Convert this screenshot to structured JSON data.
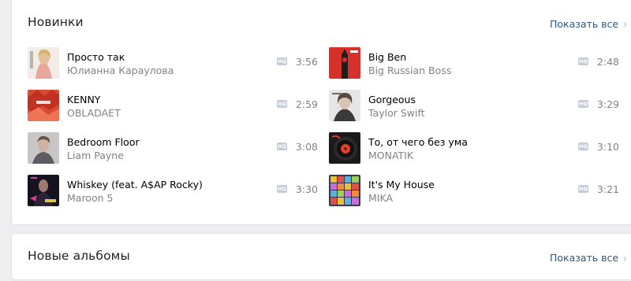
{
  "new_section": {
    "title": "Новинки",
    "show_all": "Показать все",
    "tracks": [
      {
        "title": "Просто так",
        "artist": "Юлианна Караулова",
        "quality": "HQ",
        "duration": "3:56",
        "cover_icon": "album-cover-photo-icon"
      },
      {
        "title": "Big Ben",
        "artist": "Big Russian Boss",
        "quality": "HQ",
        "duration": "2:48",
        "cover_icon": "album-cover-big-ben-icon"
      },
      {
        "title": "KENNY",
        "artist": "OBLADAET",
        "quality": "HQ",
        "duration": "2:59",
        "cover_icon": "album-cover-red-icon"
      },
      {
        "title": "Gorgeous",
        "artist": "Taylor Swift",
        "quality": "HQ",
        "duration": "3:29",
        "cover_icon": "album-cover-portrait-icon"
      },
      {
        "title": "Bedroom Floor",
        "artist": "Liam Payne",
        "quality": "HQ",
        "duration": "3:08",
        "cover_icon": "album-cover-portrait-icon"
      },
      {
        "title": "То, от чего без ума",
        "artist": "MONATIK",
        "quality": "HQ",
        "duration": "3:10",
        "cover_icon": "album-cover-vinyl-icon"
      },
      {
        "title": "Whiskey (feat. A$AP Rocky)",
        "artist": "Maroon 5",
        "quality": "HQ",
        "duration": "3:30",
        "cover_icon": "album-cover-dark-icon"
      },
      {
        "title": "It's My House",
        "artist": "MIKA",
        "quality": "HQ",
        "duration": "3:21",
        "cover_icon": "album-cover-colorful-letters-icon"
      }
    ]
  },
  "albums_section": {
    "title": "Новые альбомы",
    "show_all": "Показать все"
  },
  "colors": {
    "page_bg": "#edeef0",
    "card_bg": "#ffffff",
    "link": "#2a5885",
    "secondary_text": "#828282",
    "hq_badge": "#c4cdd7"
  }
}
